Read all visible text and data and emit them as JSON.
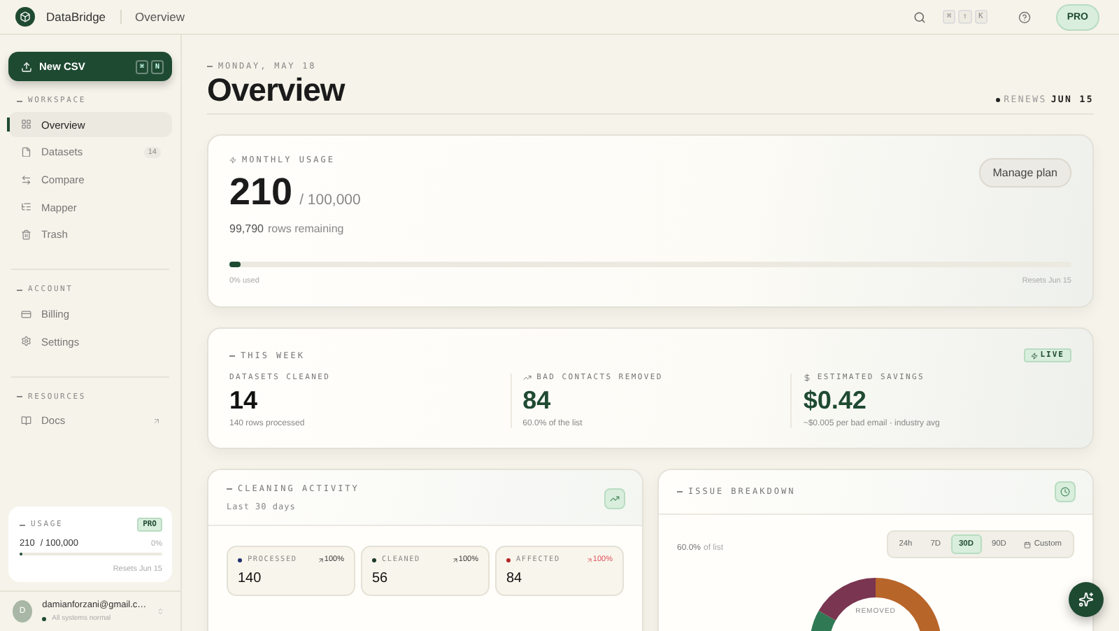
{
  "header": {
    "brand": "DataBridge",
    "page": "Overview",
    "shortcut_keys": [
      "⌘",
      "⇧",
      "K"
    ],
    "plan_badge": "PRO"
  },
  "sidebar": {
    "new_button": {
      "label": "New CSV",
      "keys": [
        "⌘",
        "N"
      ]
    },
    "sections": [
      {
        "title": "WORKSPACE",
        "items": [
          {
            "label": "Overview",
            "kind": "grid",
            "selected": true,
            "external": false
          },
          {
            "label": "Datasets",
            "kind": "file",
            "count": "14",
            "selected": false,
            "external": false
          },
          {
            "label": "Compare",
            "kind": "swap",
            "selected": false,
            "external": false
          },
          {
            "label": "Mapper",
            "kind": "list",
            "selected": false,
            "external": false
          },
          {
            "label": "Trash",
            "kind": "trash",
            "selected": false,
            "external": false
          }
        ]
      },
      {
        "title": "ACCOUNT",
        "items": [
          {
            "label": "Billing",
            "kind": "card",
            "selected": false,
            "external": false
          },
          {
            "label": "Settings",
            "kind": "gear",
            "selected": false,
            "external": false
          }
        ]
      },
      {
        "title": "RESOURCES",
        "items": [
          {
            "label": "Docs",
            "kind": "book",
            "selected": false,
            "external": true
          }
        ]
      }
    ],
    "usage": {
      "title": "USAGE",
      "badge": "PRO",
      "used": "210",
      "total": "/ 100,000",
      "percent": "0%",
      "level": 0.0021,
      "resets": "Resets Jun 15"
    },
    "user": {
      "initial": "D",
      "email": "damianforzani@gmail.c…",
      "status": "All systems normal"
    }
  },
  "main": {
    "date": "MONDAY, MAY 18",
    "title": "Overview",
    "renews": {
      "label": "RENEWS",
      "date": "JUN 15"
    },
    "monthly_usage": {
      "title": "MONTHLY USAGE",
      "used": "210",
      "total": "/ 100,000",
      "remaining_count": "99,790",
      "remaining_label": "rows remaining",
      "button": "Manage plan",
      "level": 0.0021,
      "percent_used": "0% used",
      "resets": "Resets Jun 15"
    },
    "this_week": {
      "title": "THIS WEEK",
      "live_badge": "LIVE",
      "stats": [
        {
          "label": "DATASETS CLEANED",
          "value": "14",
          "note": "140 rows processed",
          "kind": "plain"
        },
        {
          "label": "BAD CONTACTS REMOVED",
          "value": "84",
          "note": "60.0% of the list",
          "kind": "trend"
        },
        {
          "label": "ESTIMATED SAVINGS",
          "value": "$0.42",
          "note": "~$0.005 per bad email · industry avg",
          "kind": "dollar"
        }
      ]
    },
    "cleaning_activity": {
      "title": "CLEANING ACTIVITY",
      "subtitle": "Last 30 days",
      "metrics": [
        {
          "label": "PROCESSED",
          "value": "140",
          "change": "100%",
          "color": "#23306e",
          "negative": false
        },
        {
          "label": "CLEANED",
          "value": "56",
          "change": "100%",
          "color": "#1d3a2a",
          "negative": false
        },
        {
          "label": "AFFECTED",
          "value": "84",
          "change": "100%",
          "color": "#b3262b",
          "negative": true
        }
      ]
    },
    "issue_breakdown": {
      "title": "ISSUE BREAKDOWN",
      "share": "60.0%",
      "share_label": "of list",
      "ranges": [
        {
          "label": "24h",
          "kind": "preset",
          "selected": false
        },
        {
          "label": "7D",
          "kind": "preset",
          "selected": false
        },
        {
          "label": "30D",
          "kind": "preset",
          "selected": true
        },
        {
          "label": "90D",
          "kind": "preset",
          "selected": false
        },
        {
          "label": "Custom",
          "kind": "custom",
          "selected": false
        }
      ],
      "donut_label": "REMOVED"
    }
  }
}
